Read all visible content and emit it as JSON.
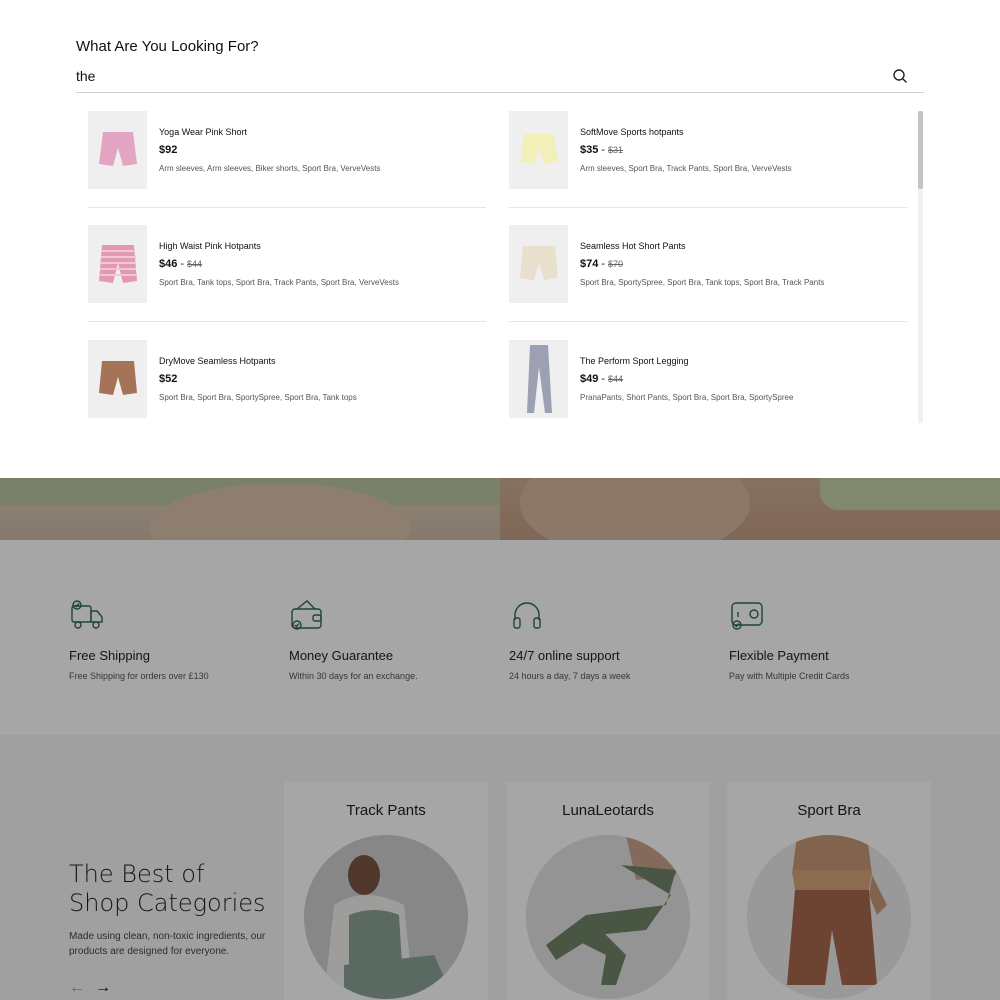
{
  "search": {
    "title": "What Are You Looking For?",
    "query": "the",
    "search_icon": "search-icon"
  },
  "results": [
    {
      "name": "Yoga Wear Pink Short",
      "price": "$92",
      "old_price": "",
      "tags": "Arm sleeves, Arm sleeves, Biker shorts, Sport Bra, VerveVests",
      "product_color": "#e2a6c2"
    },
    {
      "name": "SoftMove Sports hotpants",
      "price": "$35",
      "old_price": "$31",
      "tags": "Arm sleeves, Sport Bra, Track Pants, Sport Bra, VerveVests",
      "product_color": "#f2efb8"
    },
    {
      "name": "High Waist Pink Hotpants",
      "price": "$46",
      "old_price": "$44",
      "tags": "Sport Bra, Tank tops, Sport Bra, Track Pants, Sport Bra, VerveVests",
      "product_color": "#e29ab0"
    },
    {
      "name": "Seamless Hot Short Pants",
      "price": "$74",
      "old_price": "$70",
      "tags": "Sport Bra, SportySpree, Sport Bra, Tank tops, Sport Bra, Track Pants",
      "product_color": "#e8dfcc"
    },
    {
      "name": "DryMove Seamless Hotpants",
      "price": "$52",
      "old_price": "",
      "tags": "Sport Bra, Sport Bra, SportySpree, Sport Bra, Tank tops",
      "product_color": "#a47358"
    },
    {
      "name": "The Perform Sport Legging",
      "price": "$49",
      "old_price": "$44",
      "tags": "PranaPants, Short Pants, Sport Bra, Sport Bra, SportySpree",
      "product_color": "#9d9fb2"
    }
  ],
  "features": [
    {
      "title": "Free Shipping",
      "desc": "Free Shipping for orders over £130",
      "icon": "truck-icon"
    },
    {
      "title": "Money Guarantee",
      "desc": "Within 30 days for an exchange.",
      "icon": "wallet-icon"
    },
    {
      "title": "24/7 online support",
      "desc": "24 hours a day, 7 days a week",
      "icon": "headphones-icon"
    },
    {
      "title": "Flexible Payment",
      "desc": "Pay with Multiple Credit Cards",
      "icon": "credit-card-icon"
    }
  ],
  "categories": {
    "heading": "The Best of Shop Categories",
    "desc": "Made using clean, non-toxic ingredients, our products are designed for everyone.",
    "arrow_prev": "←",
    "arrow_next": "→",
    "items": [
      {
        "title": "Track Pants"
      },
      {
        "title": "LunaLeotards"
      },
      {
        "title": "Sport Bra"
      }
    ]
  },
  "colors": {
    "accent": "#2e6b4f",
    "overlay": "rgba(0,0,0,0.35)"
  }
}
